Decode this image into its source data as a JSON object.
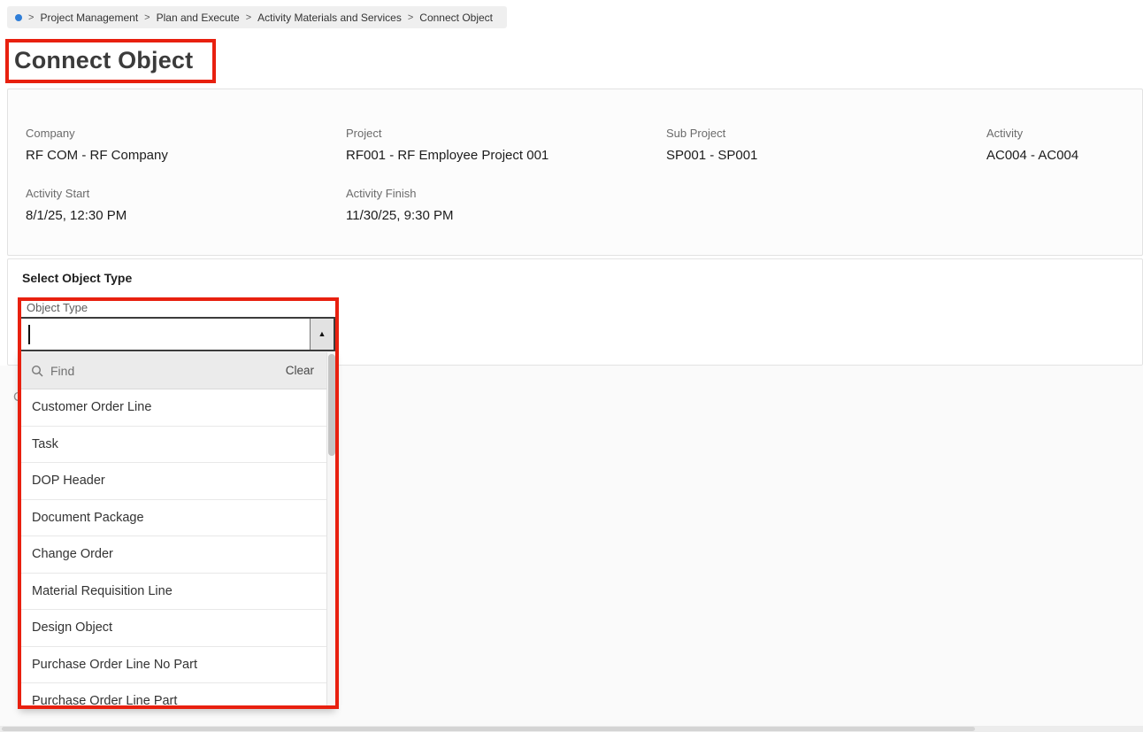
{
  "colors": {
    "annotation": "#e8200f",
    "dot-blue": "#2f7ed8"
  },
  "breadcrumb": {
    "separator": ">",
    "items": [
      "Project Management",
      "Plan and Execute",
      "Activity Materials and Services",
      "Connect Object"
    ]
  },
  "page": {
    "title": "Connect Object"
  },
  "details": {
    "fields": [
      {
        "label": "Company",
        "value": "RF COM - RF Company"
      },
      {
        "label": "Project",
        "value": "RF001 - RF Employee Project 001"
      },
      {
        "label": "Sub Project",
        "value": "SP001 - SP001"
      },
      {
        "label": "Activity",
        "value": "AC004 - AC004"
      },
      {
        "label": "Activity Start",
        "value": "8/1/25, 12:30 PM"
      },
      {
        "label": "Activity Finish",
        "value": "11/30/25, 9:30 PM"
      }
    ]
  },
  "object_type": {
    "section_title": "Select Object Type",
    "field_label": "Object Type",
    "input_value": "",
    "collapse_icon": "▲",
    "dropdown": {
      "find_placeholder": "Find",
      "clear_label": "Clear",
      "options": [
        "Customer Order Line",
        "Task",
        "DOP Header",
        "Document Package",
        "Change Order",
        "Material Requisition Line",
        "Design Object",
        "Purchase Order Line No Part",
        "Purchase Order Line Part"
      ]
    }
  },
  "background": {
    "obscured_text": "C"
  }
}
